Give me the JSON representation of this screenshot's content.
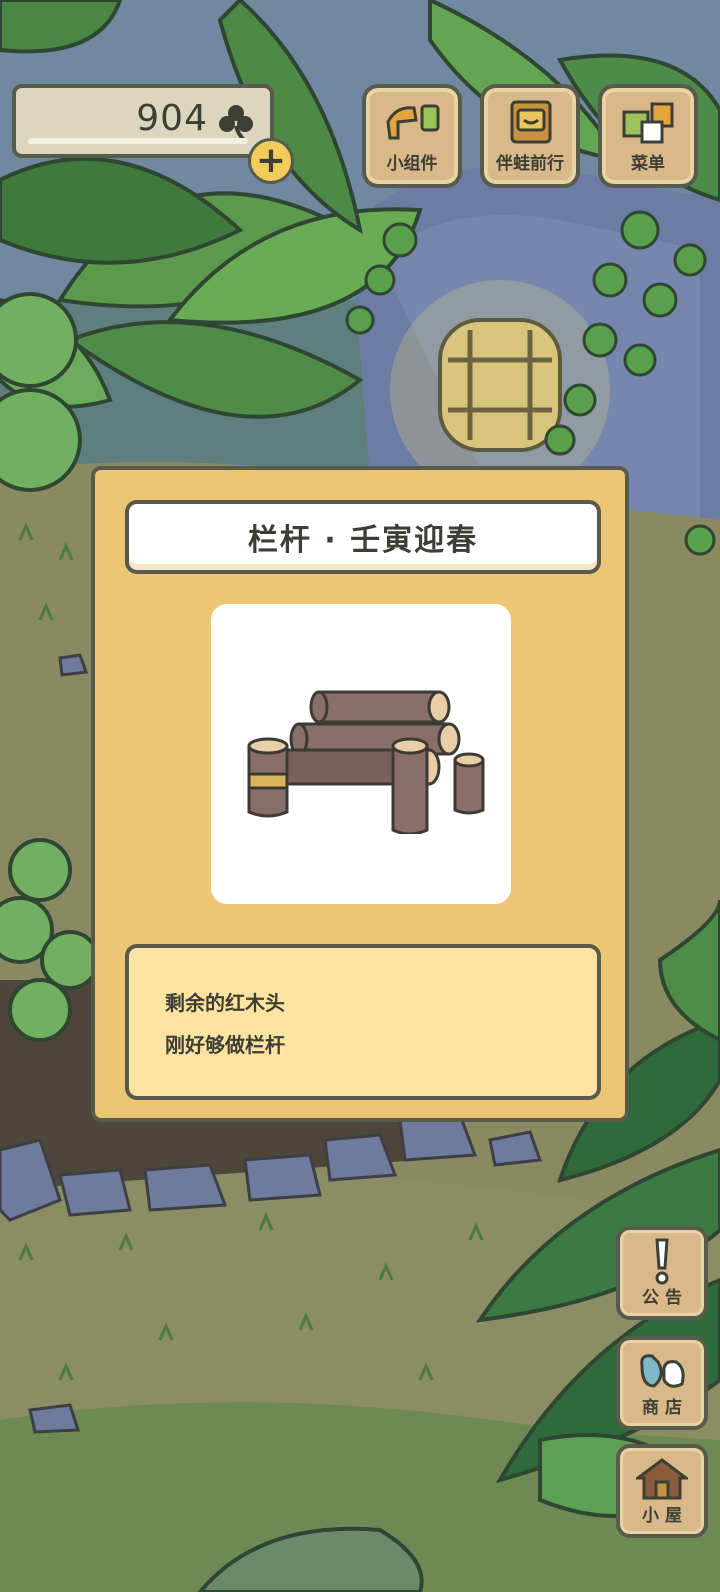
{
  "hud": {
    "clover_count": "904",
    "clover_icon": "clover-icon",
    "add_icon": "plus-icon",
    "add_label": "+"
  },
  "top_buttons": [
    {
      "label": "小组件",
      "icon": "widget-icon"
    },
    {
      "label": "伴蛙前行",
      "icon": "frog-journey-icon"
    },
    {
      "label": "菜单",
      "icon": "menu-icon"
    }
  ],
  "side_buttons": [
    {
      "label": "公告",
      "icon": "exclamation-icon"
    },
    {
      "label": "商店",
      "icon": "shop-bags-icon"
    },
    {
      "label": "小屋",
      "icon": "house-icon"
    }
  ],
  "item_card": {
    "title": "栏杆 · 壬寅迎春",
    "item_icon": "wooden-log-fence-icon",
    "description": [
      "剩余的红木头",
      "刚好够做栏杆"
    ]
  },
  "colors": {
    "card_bg": "#ecc674",
    "desc_bg": "#fde3a2",
    "button_bg": "#d9b98a",
    "outline": "#585a4c",
    "log_color": "#8a6e6a"
  }
}
